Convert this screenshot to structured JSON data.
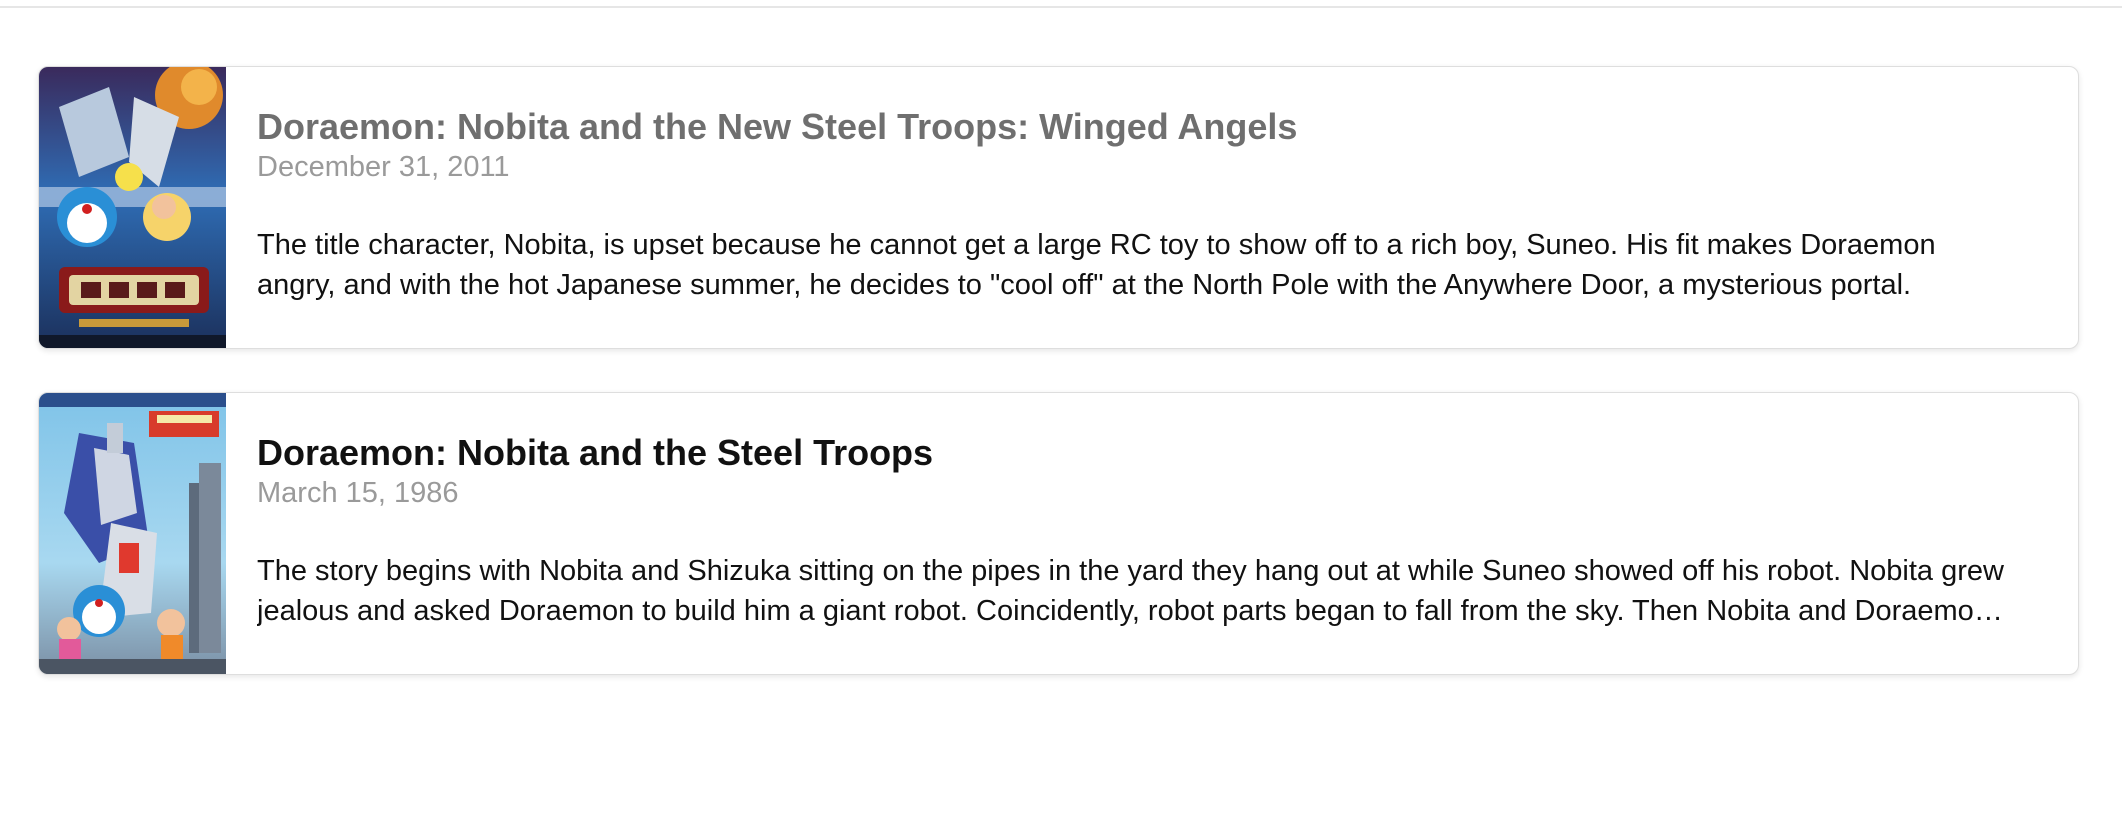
{
  "results": [
    {
      "title": "Doraemon: Nobita and the New Steel Troops: Winged Angels",
      "release_date": "December 31, 2011",
      "overview": "The title character, Nobita, is upset because he cannot get a large RC toy to show off to a rich boy, Suneo. His fit makes Doraemon angry, and with the hot Japanese summer, he decides to \"cool off\" at the North Pole with the Anywhere Door, a mysterious portal.",
      "poster_icon": "doraemon-winged-angels-poster",
      "title_color": "#6f6f6f"
    },
    {
      "title": "Doraemon: Nobita and the Steel Troops",
      "release_date": "March 15, 1986",
      "overview": "The story begins with Nobita and Shizuka sitting on the pipes in the yard they hang out at while Suneo showed off his robot. Nobita grew jealous and asked Doraemon to build him a giant robot. Coincidently, robot parts began to fall from the sky. Then Nobita and Doraemon realize the parts belong to a giant robot called Zanda Claus.",
      "poster_icon": "doraemon-steel-troops-poster",
      "title_color": "#111111"
    }
  ],
  "colors": {
    "date": "#9a9a9a",
    "border": "#dedede",
    "divider": "#e6e6e6"
  }
}
